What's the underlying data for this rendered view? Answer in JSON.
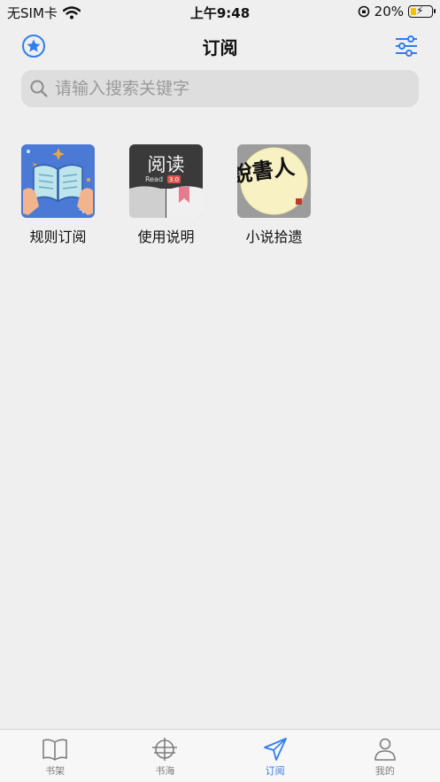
{
  "status_bar": {
    "carrier": "无SIM卡",
    "time": "上午9:48",
    "battery": "20%"
  },
  "nav": {
    "title": "订阅"
  },
  "search": {
    "placeholder": "请输入搜索关键字"
  },
  "items": [
    {
      "label": "规则订阅",
      "icon": "open-book-icon"
    },
    {
      "label": "使用说明",
      "icon": "read-app-icon",
      "thumb_text": "阅读",
      "thumb_sub": "Read",
      "thumb_badge": "3.0"
    },
    {
      "label": "小说拾遗",
      "icon": "calligraphy-icon",
      "thumb_text": "說書人"
    }
  ],
  "tabs": [
    {
      "label": "书架",
      "icon": "bookshelf-icon"
    },
    {
      "label": "书海",
      "icon": "globe-icon"
    },
    {
      "label": "订阅",
      "icon": "send-icon",
      "active": true
    },
    {
      "label": "我的",
      "icon": "person-icon"
    }
  ],
  "colors": {
    "accent": "#2f7df0",
    "background": "#efefef",
    "battery": "#f2c200"
  }
}
